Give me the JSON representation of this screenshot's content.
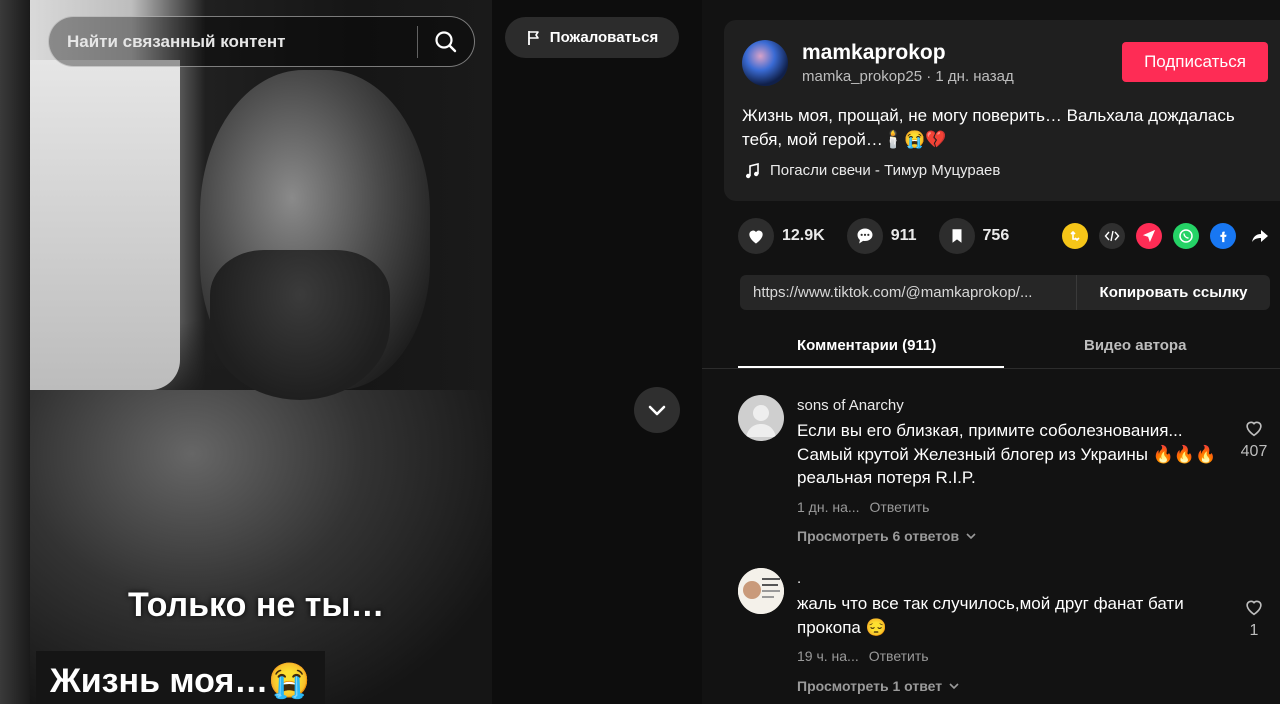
{
  "video": {
    "search_placeholder": "Найти связанный контент",
    "report_label": "Пожаловаться",
    "caption_line1": "Только не ты…",
    "caption_line2": "Жизнь моя…😭"
  },
  "author": {
    "display_name": "mamkaprokop",
    "sub_line": "mamka_prokop25 · 1 дн. назад",
    "follow_label": "Подписаться",
    "description": "Жизнь моя, прощай, не могу поверить… Вальхала дождалась тебя, мой герой…🕯️😭💔",
    "music": "Погасли свечи - Тимур Муцураев"
  },
  "stats": {
    "likes": "12.9K",
    "comments": "911",
    "saves": "756"
  },
  "share_icons": [
    "repost-icon",
    "embed-icon",
    "send-icon",
    "whatsapp-icon",
    "facebook-icon",
    "share-arrow-icon"
  ],
  "link": {
    "url": "https://www.tiktok.com/@mamkaprokop/...",
    "copy_label": "Копировать ссылку"
  },
  "tabs": {
    "comments": "Комментарии (911)",
    "videos": "Видео автора"
  },
  "comments": [
    {
      "name": "sons of Anarchy",
      "text": "Если вы его близкая, примите соболезнования... Самый крутой Железный блогер из Украины 🔥🔥🔥 реальная потеря R.I.P.",
      "time": "1 дн. на...",
      "reply": "Ответить",
      "replies": "Просмотреть 6 ответов",
      "likes": "407"
    },
    {
      "name": ".",
      "text": "жаль что все так случилось,мой друг фанат бати прокопа 😔",
      "time": "19 ч. на...",
      "reply": "Ответить",
      "replies": "Просмотреть 1 ответ",
      "likes": "1"
    }
  ],
  "colors": {
    "accent": "#fe2c55",
    "panel_bg": "#121212",
    "card_bg": "#1f1f1f"
  }
}
